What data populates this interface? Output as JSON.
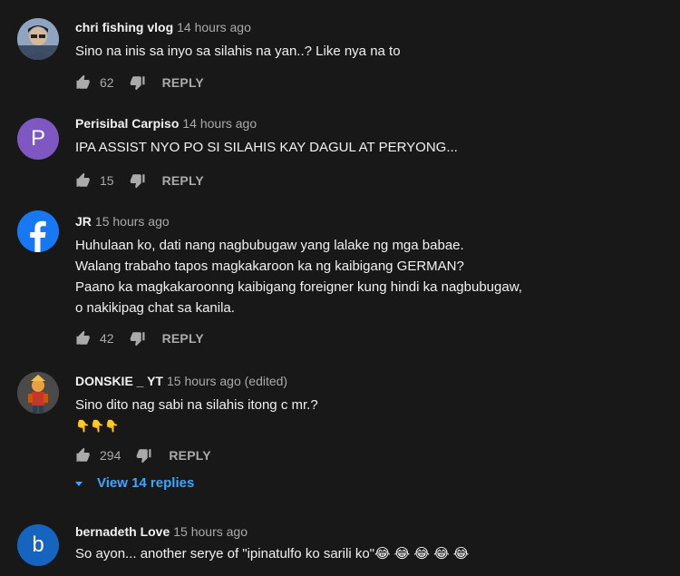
{
  "comments": [
    {
      "author": "chri fishing vlog",
      "time": "14 hours ago",
      "lines": [
        "Sino na inis sa inyo sa silahis na yan..? Like nya na to"
      ],
      "likes": "62",
      "reply_label": "REPLY",
      "avatar_color": "#5a6f8a"
    },
    {
      "author": "Perisibal Carpiso",
      "time": "14 hours ago",
      "lines": [
        "IPA ASSIST NYO PO SI SILAHIS KAY DAGUL AT PERYONG..."
      ],
      "likes": "15",
      "reply_label": "REPLY",
      "avatar_letter": "P",
      "avatar_color": "#7e57c2"
    },
    {
      "author": "JR",
      "time": "15 hours ago",
      "lines": [
        "Huhulaan ko, dati nang nagbubugaw yang lalake ng mga babae.",
        "Walang trabaho tapos magkakaroon ka ng kaibigang GERMAN?",
        "Paano ka magkakaroonng kaibigang foreigner kung hindi ka nagbubugaw,",
        "o nakikipag chat sa kanila."
      ],
      "likes": "42",
      "reply_label": "REPLY",
      "avatar_color": "#1877f2"
    },
    {
      "author": "DONSKIE _ YT",
      "time": "15 hours ago (edited)",
      "lines": [
        "Sino dito nag sabi na silahis itong c mr.?",
        "👇👇👇"
      ],
      "likes": "294",
      "reply_label": "REPLY",
      "avatar_color": "#3a3a3a"
    },
    {
      "author": "bernadeth Love",
      "time": "15 hours ago",
      "lines": [
        "So ayon... another serye of \"ipinatulfo ko sarili ko\"😂 😂 😂 😂 😂"
      ],
      "avatar_letter": "b",
      "avatar_color": "#1565c0"
    }
  ],
  "view_replies_label": "View 14 replies",
  "colors": {
    "background": "#181818",
    "link": "#3ea6ff",
    "muted": "#aaaaaa"
  }
}
